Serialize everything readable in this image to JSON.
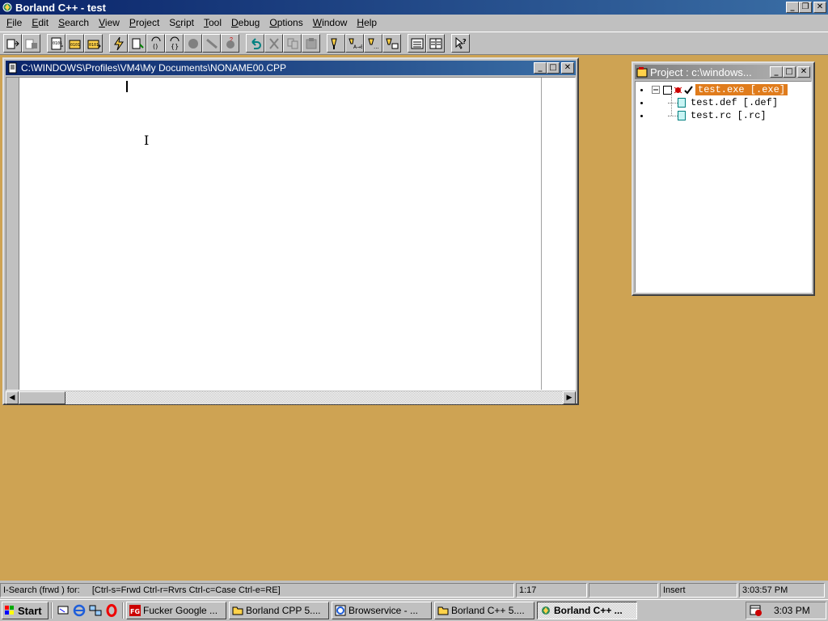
{
  "app": {
    "title": "Borland C++ - test"
  },
  "menu": [
    {
      "pre": "",
      "key": "F",
      "post": "ile"
    },
    {
      "pre": "",
      "key": "E",
      "post": "dit"
    },
    {
      "pre": "",
      "key": "S",
      "post": "earch"
    },
    {
      "pre": "",
      "key": "V",
      "post": "iew"
    },
    {
      "pre": "",
      "key": "P",
      "post": "roject"
    },
    {
      "pre": "S",
      "key": "c",
      "post": "ript"
    },
    {
      "pre": "",
      "key": "T",
      "post": "ool"
    },
    {
      "pre": "",
      "key": "D",
      "post": "ebug"
    },
    {
      "pre": "",
      "key": "O",
      "post": "ptions"
    },
    {
      "pre": "",
      "key": "W",
      "post": "indow"
    },
    {
      "pre": "",
      "key": "H",
      "post": "elp"
    }
  ],
  "editor": {
    "title": "C:\\WINDOWS\\Profiles\\VM4\\My Documents\\NONAME00.CPP"
  },
  "project": {
    "title": "Project : c:\\windows...",
    "nodes": [
      {
        "label": "test.exe [.exe]"
      },
      {
        "label": "test.def [.def]"
      },
      {
        "label": "test.rc [.rc]"
      }
    ]
  },
  "status": {
    "message": "I-Search (frwd ) for:",
    "hint": "[Ctrl-s=Frwd Ctrl-r=Rvrs Ctrl-c=Case Ctrl-e=RE]",
    "position": "1:17",
    "modified": "",
    "mode": "Insert",
    "time": "3:03:57 PM"
  },
  "taskbar": {
    "start_label": "Start",
    "tasks": [
      {
        "label": "Fucker Google ..."
      },
      {
        "label": "Borland CPP 5...."
      },
      {
        "label": "Browservice - ..."
      },
      {
        "label": "Borland C++ 5...."
      },
      {
        "label": "Borland C++ ..."
      }
    ],
    "clock": "3:03 PM"
  },
  "colors": {
    "desktop": "#cea353",
    "active_title": "#0a246a",
    "selection": "#e07c1c"
  }
}
